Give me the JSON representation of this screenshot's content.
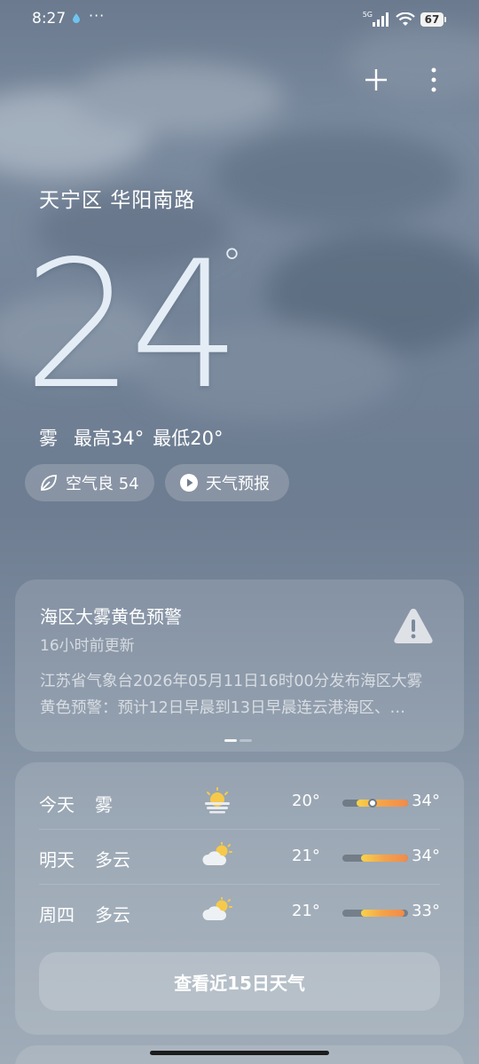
{
  "status_bar": {
    "time": "8:27",
    "dots": "···",
    "network": "5G",
    "battery": "67"
  },
  "header": {
    "location": "天宁区 华阳南路",
    "temperature": "24",
    "degree": "°",
    "condition": "雾",
    "high": "最高34°",
    "low": "最低20°"
  },
  "chips": {
    "aqi": "空气良 54",
    "forecast_video": "天气预报"
  },
  "alert": {
    "title": "海区大雾黄色预警",
    "updated": "16小时前更新",
    "body": "江苏省气象台2026年05月11日16时00分发布海区大雾\n黄色预警：预计12日早晨到13日早晨连云港海区、…"
  },
  "forecast": {
    "days": [
      {
        "day": "今天",
        "condition": "雾",
        "icon": "fog-sun-icon",
        "low": "20°",
        "high": "34°",
        "bar_start": 0.22,
        "bar_end": 1.0,
        "current": 0.46
      },
      {
        "day": "明天",
        "condition": "多云",
        "icon": "partly-cloudy-icon",
        "low": "21°",
        "high": "34°",
        "bar_start": 0.28,
        "bar_end": 1.0
      },
      {
        "day": "周四",
        "condition": "多云",
        "icon": "partly-cloudy-icon",
        "low": "21°",
        "high": "33°",
        "bar_start": 0.28,
        "bar_end": 0.95
      }
    ],
    "view_15_label": "查看近15日天气"
  },
  "colors": {
    "bar_start": "#f7d34a",
    "bar_end": "#f08b4b"
  }
}
